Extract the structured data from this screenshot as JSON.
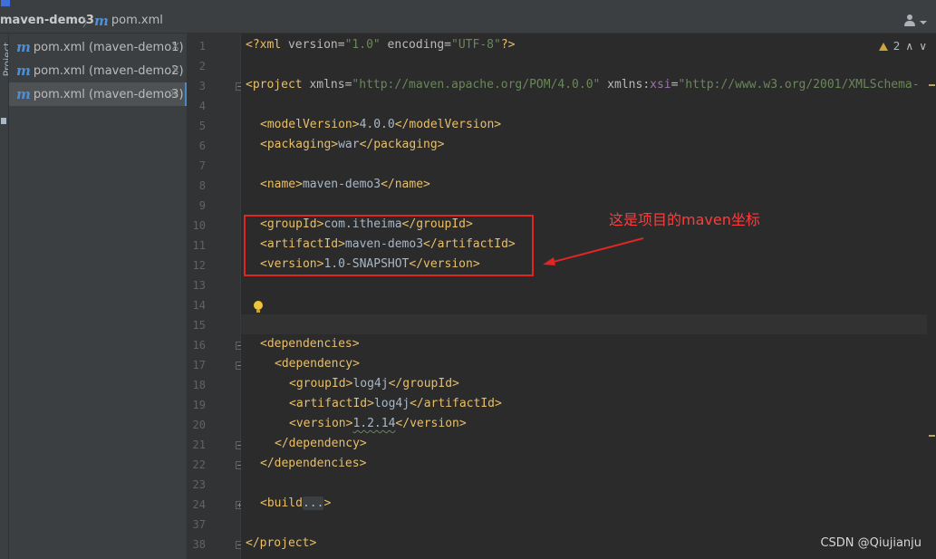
{
  "breadcrumb": {
    "project": "maven-demo3",
    "separator": "〉",
    "file": "pom.xml"
  },
  "tool_window": {
    "label": "Project"
  },
  "tabs": [
    {
      "label": "pom.xml (maven-demo1)",
      "close": "×"
    },
    {
      "label": "pom.xml (maven-demo2)",
      "close": "×"
    },
    {
      "label": "pom.xml (maven-demo3)",
      "close": "×"
    }
  ],
  "inspection": {
    "count": "2",
    "up": "∧",
    "down": "∨"
  },
  "lines": [
    {
      "n": "1"
    },
    {
      "n": "2"
    },
    {
      "n": "3"
    },
    {
      "n": "4"
    },
    {
      "n": "5"
    },
    {
      "n": "6"
    },
    {
      "n": "7"
    },
    {
      "n": "8"
    },
    {
      "n": "9"
    },
    {
      "n": "10"
    },
    {
      "n": "11"
    },
    {
      "n": "12"
    },
    {
      "n": "13"
    },
    {
      "n": "14"
    },
    {
      "n": "15"
    },
    {
      "n": "16"
    },
    {
      "n": "17"
    },
    {
      "n": "18"
    },
    {
      "n": "19"
    },
    {
      "n": "20"
    },
    {
      "n": "21"
    },
    {
      "n": "22"
    },
    {
      "n": "23"
    },
    {
      "n": "24"
    },
    {
      "n": "37"
    },
    {
      "n": "38"
    }
  ],
  "code": {
    "l1_decl_open": "<?xml ",
    "l1_version_attr": "version=",
    "l1_version_val": "\"1.0\"",
    "l1_encoding_attr": " encoding=",
    "l1_encoding_val": "\"UTF-8\"",
    "l1_decl_close": "?>",
    "l3_open": "<project ",
    "l3_xmlns_attr": "xmlns=",
    "l3_xmlns_val": "\"http://maven.apache.org/POM/4.0.0\"",
    "l3_xmlns2_attr": " xmlns:",
    "l3_xsi": "xsi",
    "l3_eq": "=",
    "l3_xsi_val": "\"http://www.w3.org/2001/XMLSchema-",
    "modelVersion_open": "<modelVersion>",
    "modelVersion_val": "4.0.0",
    "modelVersion_close": "</modelVersion>",
    "packaging_open": "<packaging>",
    "packaging_val": "war",
    "packaging_close": "</packaging>",
    "name_open": "<name>",
    "name_val": "maven-demo3",
    "name_close": "</name>",
    "groupId_open": "<groupId>",
    "groupId_val": "com.itheima",
    "groupId_close": "</groupId>",
    "artifactId_open": "<artifactId>",
    "artifactId_val": "maven-demo3",
    "artifactId_close": "</artifactId>",
    "version_open": "<version>",
    "version_val": "1.0-SNAPSHOT",
    "version_close": "</version>",
    "deps_open": "<dependencies>",
    "dep_open": "<dependency>",
    "dep_groupId_val": "log4j",
    "dep_artifactId_val": "log4j",
    "dep_version_val": "1.2.14",
    "dep_close": "</dependency>",
    "deps_close": "</dependencies>",
    "build_open": "<build",
    "build_fold": "...",
    "build_close": ">",
    "project_close": "</project>"
  },
  "annotation": {
    "text": "这是项目的maven坐标",
    "color": "#e02525"
  },
  "watermark": "CSDN @Qiujianju"
}
